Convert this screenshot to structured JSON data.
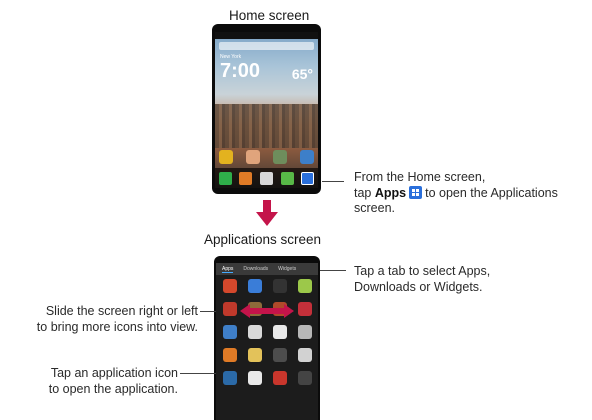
{
  "home_caption": "Home screen",
  "apps_caption": "Applications screen",
  "home_phone": {
    "city": "New York",
    "time": "7:00",
    "temp": "65°"
  },
  "apps_phone": {
    "tabs": [
      "Apps",
      "Downloads",
      "Widgets"
    ]
  },
  "annotations": {
    "apps_button": {
      "line1": "From the Home screen,",
      "line2_pre": "tap",
      "line2_bold": "Apps",
      "line2_post": "to open the Applications",
      "line3": "screen."
    },
    "tabs": {
      "line1": "Tap a tab to select Apps,",
      "line2": "Downloads or Widgets."
    },
    "slide": {
      "line1": "Slide the screen right or left",
      "line2": "to bring more icons into view."
    },
    "tap_icon": {
      "line1": "Tap an application icon",
      "line2": "to open the application."
    }
  },
  "colors": {
    "down_arrow": "#c4144a",
    "swipe_arrow": "#c4144a",
    "apps_icon": "#2a6fdb"
  },
  "icons": [
    "apps-grid-icon",
    "down-arrow-icon",
    "swipe-arrow-icon"
  ]
}
